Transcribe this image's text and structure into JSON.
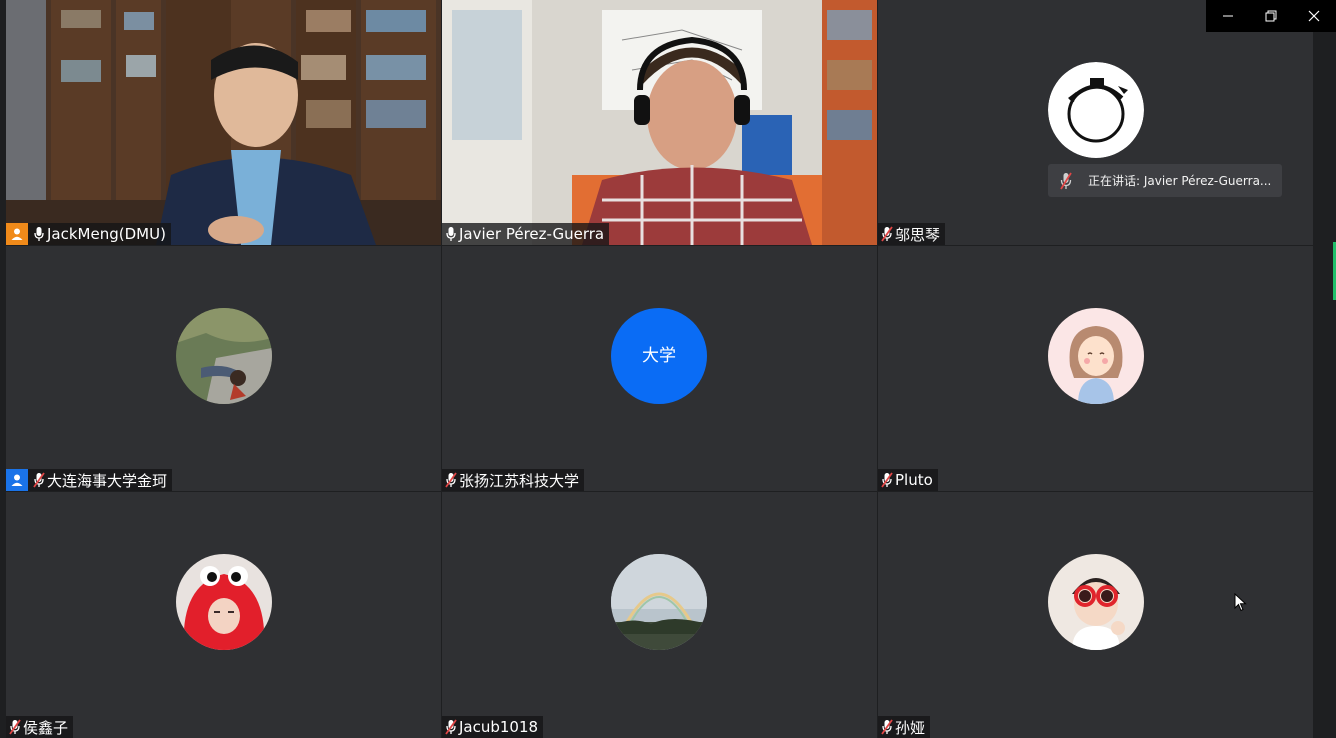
{
  "speaking_indicator": {
    "text": "正在讲话: Javier Pérez-Guerra..."
  },
  "participants": [
    {
      "name": "JackMeng(DMU)",
      "role": "host",
      "mic": "on",
      "media": "video"
    },
    {
      "name": "Javier Pérez-Guerra",
      "role": "",
      "mic": "on",
      "media": "video",
      "active": true
    },
    {
      "name": "邬思琴",
      "role": "",
      "mic": "muted",
      "media": "avatar",
      "avatar": "robot-ring-avatar"
    },
    {
      "name": "大连海事大学金珂",
      "role": "cohost",
      "mic": "muted",
      "media": "avatar",
      "avatar": "person-lying-on-grass-photo"
    },
    {
      "name": "张扬江苏科技大学",
      "role": "",
      "mic": "muted",
      "media": "avatar",
      "avatar_text": "大学"
    },
    {
      "name": "Pluto",
      "role": "",
      "mic": "muted",
      "media": "avatar",
      "avatar": "cartoon-girl-avatar"
    },
    {
      "name": "侯鑫子",
      "role": "",
      "mic": "muted",
      "media": "avatar",
      "avatar": "red-crab-costume-photo"
    },
    {
      "name": "Jacub1018",
      "role": "",
      "mic": "muted",
      "media": "avatar",
      "avatar": "rainbow-landscape-photo"
    },
    {
      "name": "孙娅",
      "role": "",
      "mic": "muted",
      "media": "avatar",
      "avatar": "child-red-glasses-photo"
    }
  ],
  "colors": {
    "tile_bg": "#2f3033",
    "active_border": "#1fbf6a",
    "host_badge": "#f08a1a",
    "cohost_badge": "#1a73e8",
    "text_avatar_bg": "#0a6cf5",
    "muted_mic": "#e04646"
  },
  "window_controls": {
    "minimize": "minimize-icon",
    "restore": "restore-icon",
    "close": "close-icon"
  }
}
